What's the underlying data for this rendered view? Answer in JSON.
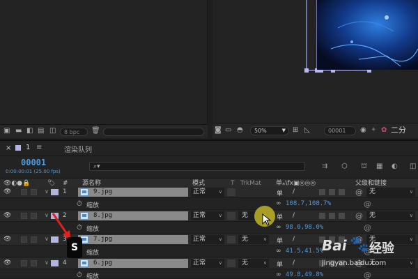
{
  "top": {
    "bpc_label": "8 bpc",
    "zoom": "50%",
    "timecode": "00001",
    "channel_label": "二分"
  },
  "timeline": {
    "tab_label": "1",
    "render_queue": "渲染队列",
    "current_time": "00001",
    "time_sub": "0:00:00:01 (25.00 fps)",
    "search_placeholder": "",
    "columns": {
      "number": "#",
      "source_name": "源名称",
      "mode": "模式",
      "t": "T",
      "trkmat": "TrkMat",
      "parent": "父级和链接"
    },
    "layers": [
      {
        "num": "1",
        "name": "9.jpg",
        "mode": "正常",
        "trkmat": "",
        "parent": "无",
        "prop": "缩放",
        "value": "108.7,108.7%"
      },
      {
        "num": "2",
        "name": "8.jpg",
        "mode": "正常",
        "trkmat": "无",
        "parent": "无",
        "prop": "缩放",
        "value": "98.0,98.0%"
      },
      {
        "num": "3",
        "name": "7.jpg",
        "mode": "正常",
        "trkmat": "无",
        "parent": "无",
        "prop": "缩放",
        "value": "41.5,41.5%"
      },
      {
        "num": "4",
        "name": "6.jpg",
        "mode": "正常",
        "trkmat": "无",
        "parent": "无",
        "prop": "缩放",
        "value": "49.8,49.8%"
      }
    ]
  },
  "overlay": {
    "badge": "S",
    "watermark_brand": "Bai",
    "watermark_cn": "经验",
    "watermark_url": "jingyan.baidu.com"
  },
  "colors": {
    "accent_blue": "#4f9be0",
    "label_lavender": "#b4b4e2",
    "cursor_yellow": "#d6c828",
    "arrow_red": "#e0201c"
  }
}
